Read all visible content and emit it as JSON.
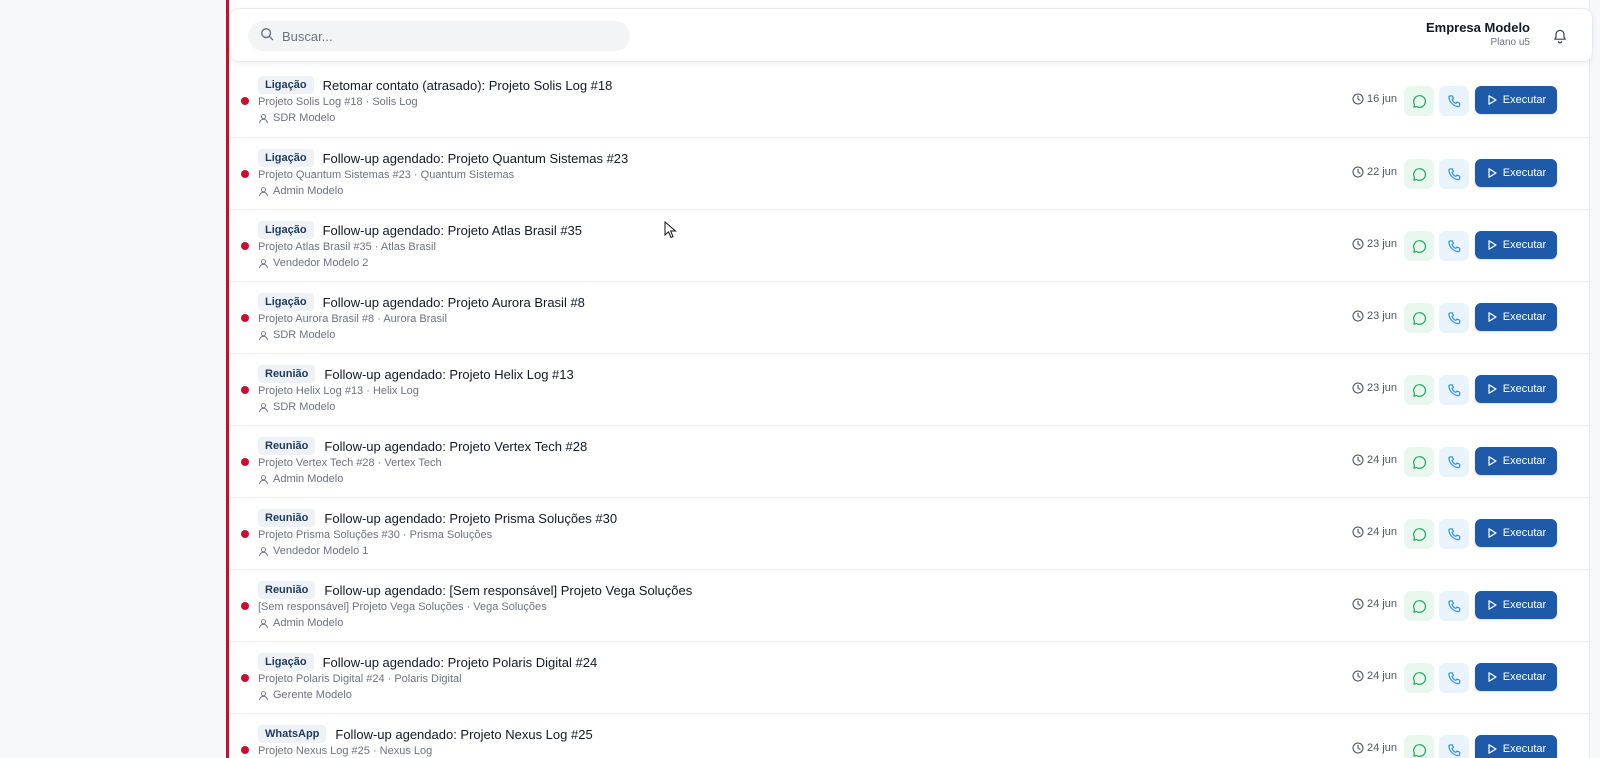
{
  "search": {
    "placeholder": "Buscar..."
  },
  "company": {
    "name": "Empresa Modelo",
    "plan": "Plano u5"
  },
  "actions": {
    "execute_label": "Executar"
  },
  "colors": {
    "accent": "#1e5aa8",
    "overdue_dot": "#c8102e",
    "whatsapp": "#22a45d",
    "call": "#2b8fd6"
  },
  "tasks": [
    {
      "type": "Ligação",
      "title": "Retomar contato (atrasado): Projeto Solis Log #18",
      "subtitle": "Projeto Solis Log #18 · Solis Log",
      "owner": "SDR Modelo",
      "date": "16 jun"
    },
    {
      "type": "Ligação",
      "title": "Follow-up agendado: Projeto Quantum Sistemas #23",
      "subtitle": "Projeto Quantum Sistemas #23 · Quantum Sistemas",
      "owner": "Admin Modelo",
      "date": "22 jun"
    },
    {
      "type": "Ligação",
      "title": "Follow-up agendado: Projeto Atlas Brasil #35",
      "subtitle": "Projeto Atlas Brasil #35 · Atlas Brasil",
      "owner": "Vendedor Modelo 2",
      "date": "23 jun"
    },
    {
      "type": "Ligação",
      "title": "Follow-up agendado: Projeto Aurora Brasil #8",
      "subtitle": "Projeto Aurora Brasil #8 · Aurora Brasil",
      "owner": "SDR Modelo",
      "date": "23 jun"
    },
    {
      "type": "Reunião",
      "title": "Follow-up agendado: Projeto Helix Log #13",
      "subtitle": "Projeto Helix Log #13 · Helix Log",
      "owner": "SDR Modelo",
      "date": "23 jun"
    },
    {
      "type": "Reunião",
      "title": "Follow-up agendado: Projeto Vertex Tech #28",
      "subtitle": "Projeto Vertex Tech #28 · Vertex Tech",
      "owner": "Admin Modelo",
      "date": "24 jun"
    },
    {
      "type": "Reunião",
      "title": "Follow-up agendado: Projeto Prisma Soluções #30",
      "subtitle": "Projeto Prisma Soluções #30 · Prisma Soluções",
      "owner": "Vendedor Modelo 1",
      "date": "24 jun"
    },
    {
      "type": "Reunião",
      "title": "Follow-up agendado: [Sem responsável] Projeto Vega Soluções",
      "subtitle": "[Sem responsável] Projeto Vega Soluções · Vega Soluções",
      "owner": "Admin Modelo",
      "date": "24 jun"
    },
    {
      "type": "Ligação",
      "title": "Follow-up agendado: Projeto Polaris Digital #24",
      "subtitle": "Projeto Polaris Digital #24 · Polaris Digital",
      "owner": "Gerente Modelo",
      "date": "24 jun"
    },
    {
      "type": "WhatsApp",
      "title": "Follow-up agendado: Projeto Nexus Log #25",
      "subtitle": "Projeto Nexus Log #25 · Nexus Log",
      "owner": "",
      "date": "24 jun"
    }
  ]
}
